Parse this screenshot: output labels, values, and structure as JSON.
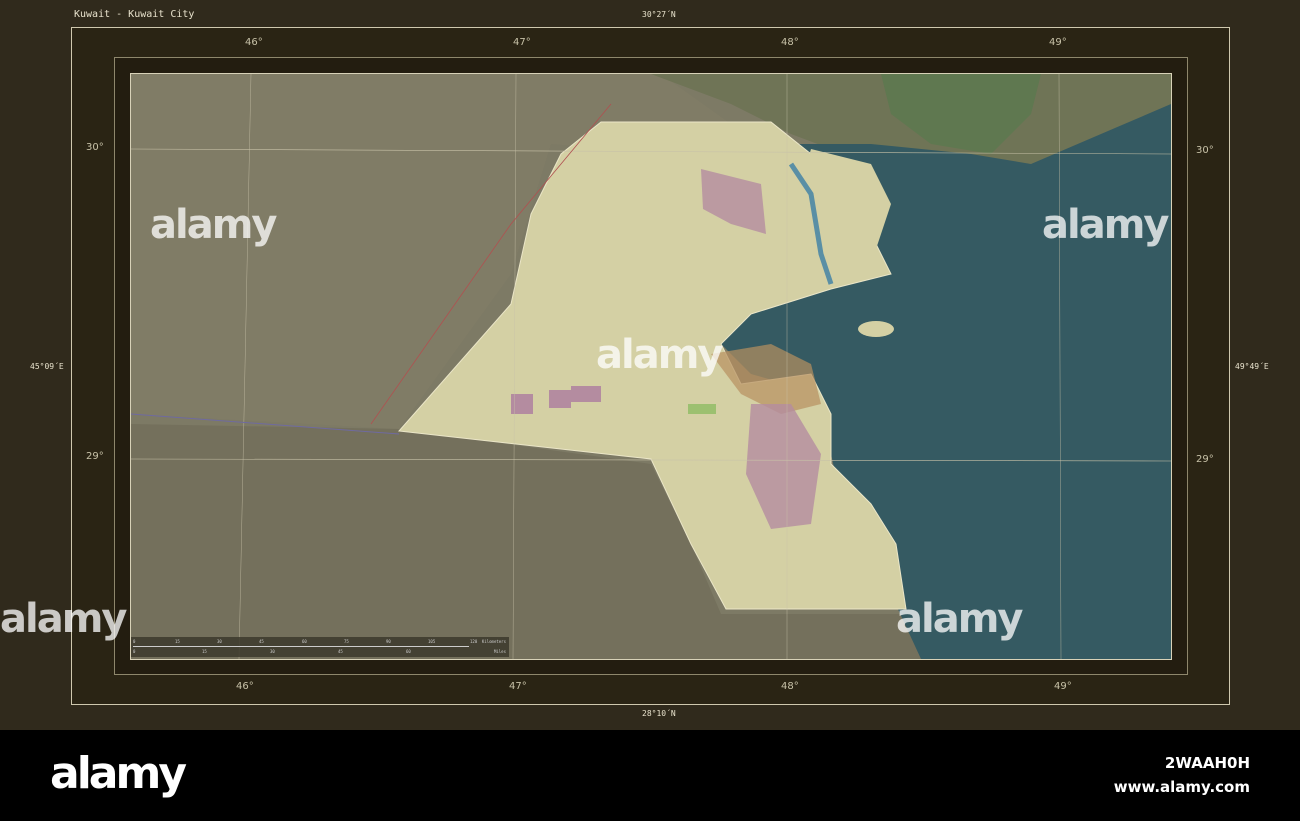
{
  "title": "Kuwait - Kuwait City",
  "bounds": {
    "north": "30°27´N",
    "south": "28°10´N",
    "west": "45°09´E",
    "east": "49°49´E"
  },
  "lon_ticks": [
    "46°",
    "47°",
    "48°",
    "49°"
  ],
  "lat_ticks": [
    "30°",
    "29°"
  ],
  "scale": {
    "km_label": "Kilometers",
    "km": [
      "0",
      "15",
      "30",
      "45",
      "60",
      "75",
      "90",
      "105",
      "120"
    ],
    "mi_label": "Miles",
    "mi": [
      "0",
      "15",
      "30",
      "45",
      "60"
    ]
  },
  "watermark": "alamy",
  "footer": {
    "logo": "alamy",
    "image_id": "2WAAH0H",
    "site": "www.alamy.com"
  },
  "colors": {
    "land": "#7d7a65",
    "kuwait": "#d4d0a4",
    "sea": "#355a62",
    "urban": "#b89060"
  }
}
